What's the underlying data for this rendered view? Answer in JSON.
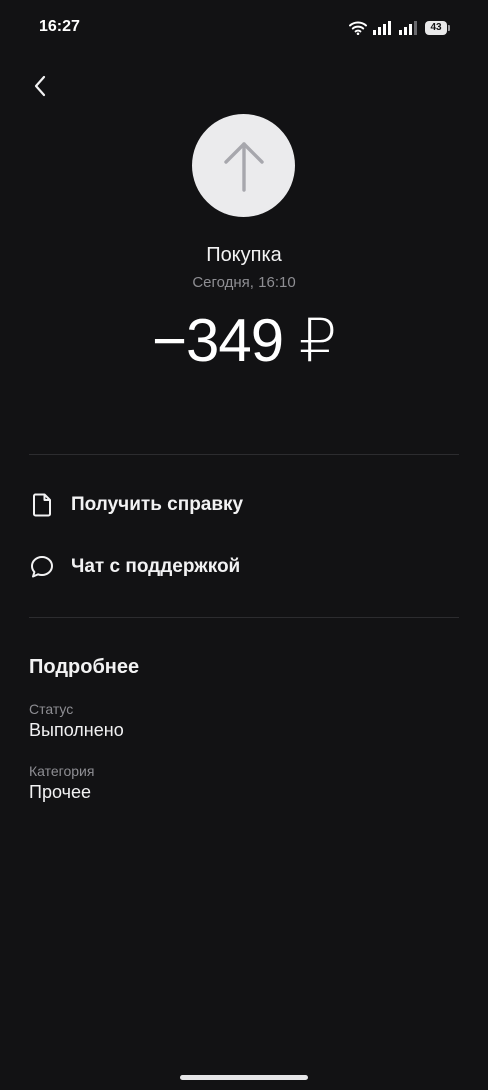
{
  "status_bar": {
    "time": "16:27",
    "battery": "43"
  },
  "header": {
    "back_icon": "chevron-left-icon"
  },
  "transaction": {
    "icon": "arrow-up-icon",
    "title": "Покупка",
    "datetime": "Сегодня, 16:10",
    "amount": "−349 ₽"
  },
  "actions": [
    {
      "icon": "document-icon",
      "label": "Получить справку"
    },
    {
      "icon": "chat-bubble-icon",
      "label": "Чат с поддержкой"
    }
  ],
  "details": {
    "title": "Подробнее",
    "fields": [
      {
        "label": "Статус",
        "value": "Выполнено"
      },
      {
        "label": "Категория",
        "value": "Прочее"
      }
    ]
  },
  "colors": {
    "background": "#121214",
    "text_primary": "#f2f2f3",
    "text_secondary": "#8e8e93",
    "divider": "#2c2c2f",
    "icon_circle": "#ebebed",
    "icon_arrow": "#a7a7ad"
  }
}
